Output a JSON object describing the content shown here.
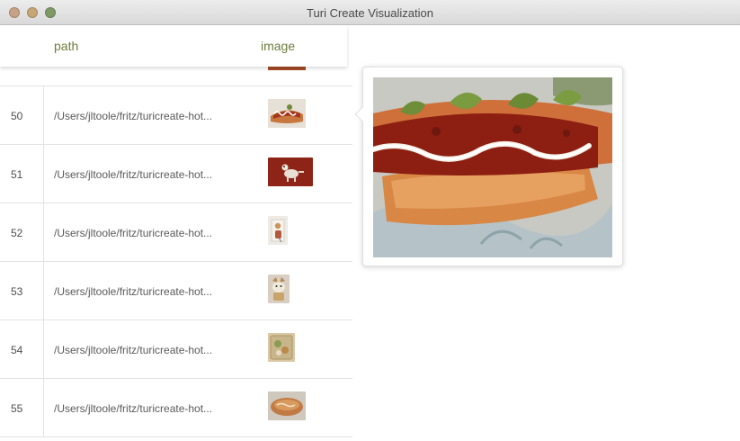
{
  "window": {
    "title": "Turi Create Visualization"
  },
  "table": {
    "columns": {
      "path": "path",
      "image": "image"
    },
    "rows": [
      {
        "index": "50",
        "path": "/Users/jltoole/fritz/turicreate-hot...",
        "thumb": "hot-dog-sandwich"
      },
      {
        "index": "51",
        "path": "/Users/jltoole/fritz/turicreate-hot...",
        "thumb": "dog-on-red-background"
      },
      {
        "index": "52",
        "path": "/Users/jltoole/fritz/turicreate-hot...",
        "thumb": "small-portrait-dog"
      },
      {
        "index": "53",
        "path": "/Users/jltoole/fritz/turicreate-hot...",
        "thumb": "dog-portrait"
      },
      {
        "index": "54",
        "path": "/Users/jltoole/fritz/turicreate-hot...",
        "thumb": "food-tray"
      },
      {
        "index": "55",
        "path": "/Users/jltoole/fritz/turicreate-hot...",
        "thumb": "bread-loaf"
      }
    ]
  },
  "preview": {
    "subject": "hot-dog-with-relish-and-mayo"
  },
  "colors": {
    "header_text": "#6d7d3c",
    "traffic_close": "#c9a285",
    "traffic_min": "#c7a676",
    "traffic_max": "#7f9a66"
  }
}
